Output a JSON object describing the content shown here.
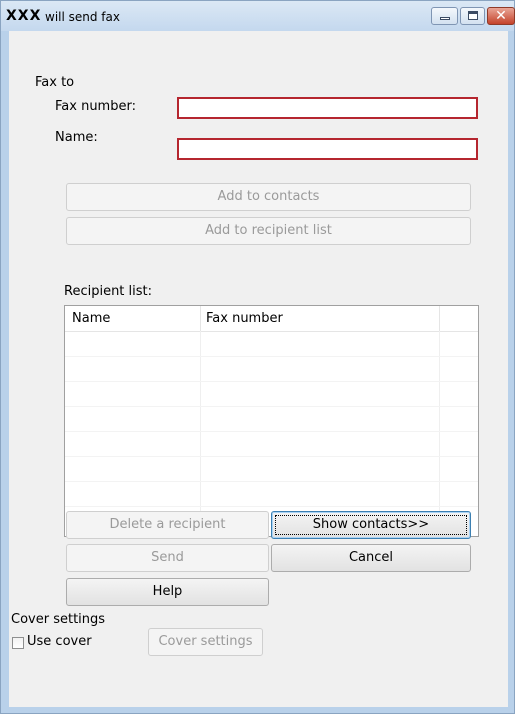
{
  "window": {
    "title_app": "XXX",
    "title_text": "will send fax"
  },
  "fax_to": {
    "section_label": "Fax to",
    "fax_number_label": "Fax number:",
    "fax_number_value": "",
    "name_label": "Name:",
    "name_value": ""
  },
  "buttons": {
    "add_to_contacts": "Add to contacts",
    "add_to_recipient_list": "Add to recipient list",
    "delete_recipient": "Delete a recipient",
    "show_contacts": "Show contacts>>",
    "send": "Send",
    "cancel": "Cancel",
    "help": "Help"
  },
  "recipient_list": {
    "label": "Recipient list:",
    "columns": [
      "Name",
      "Fax number"
    ],
    "rows": []
  },
  "cover": {
    "section_label": "Cover settings",
    "use_cover_label": "Use cover",
    "use_cover_checked": false,
    "cover_settings_button": "Cover settings"
  },
  "colors": {
    "required_field_border": "#b5262f",
    "window_frame": "#b9d1ea",
    "client_bg": "#f0f0f0"
  }
}
